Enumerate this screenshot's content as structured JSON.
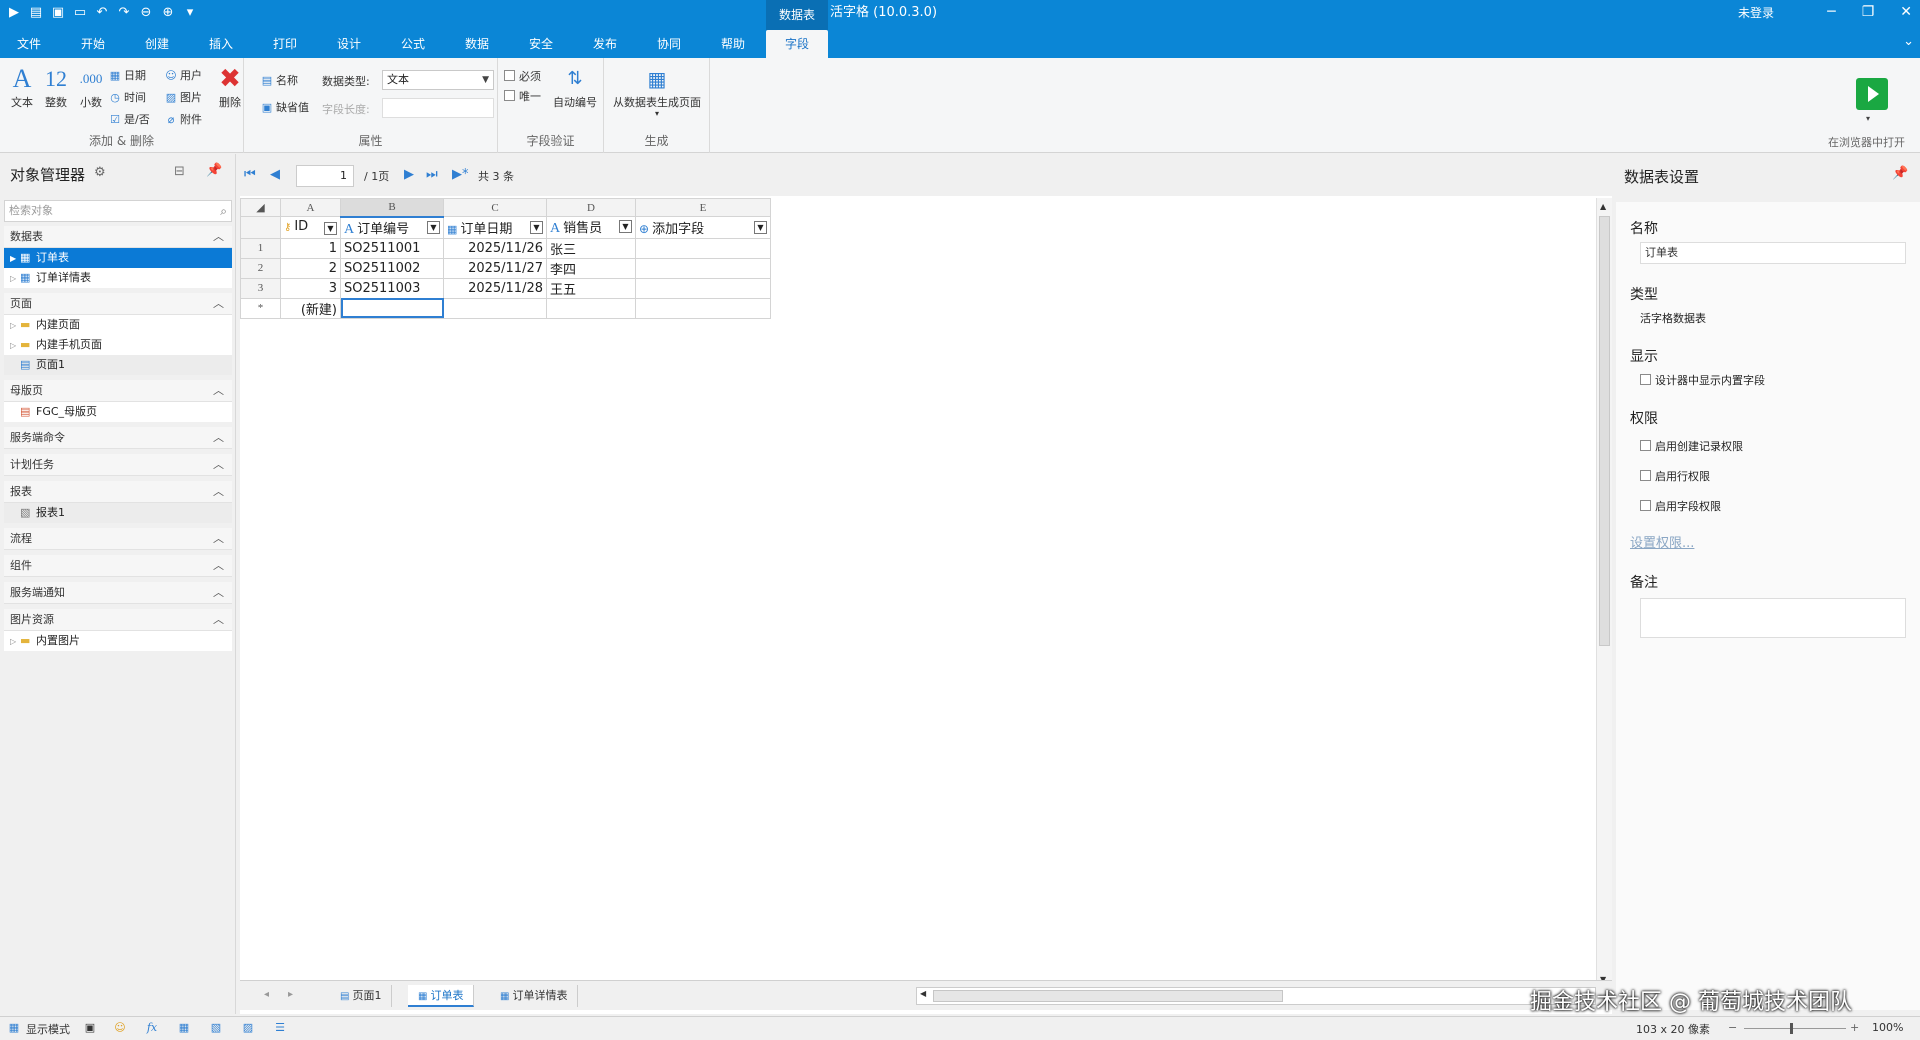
{
  "titlebar": {
    "context_tab": "数据表",
    "app_title": "活字格 (10.0.3.0)",
    "login": "未登录",
    "minimize": "─",
    "restore": "❐",
    "close": "✕"
  },
  "ribbon_tabs": [
    "文件",
    "开始",
    "创建",
    "插入",
    "打印",
    "设计",
    "公式",
    "数据",
    "安全",
    "发布",
    "协同",
    "帮助",
    "字段"
  ],
  "ribbon": {
    "add_delete": {
      "label": "添加 & 删除",
      "text": "文本",
      "int": "整数",
      "decimal": "小数",
      "date": "日期",
      "time": "时间",
      "bool": "是/否",
      "user": "用户",
      "image": "图片",
      "attachment": "附件",
      "delete": "删除"
    },
    "properties": {
      "label": "属性",
      "name": "名称",
      "default": "缺省值",
      "data_type_label": "数据类型:",
      "data_type_value": "文本",
      "length_label": "字段长度:"
    },
    "validation": {
      "label": "字段验证",
      "required": "必须",
      "unique": "唯一",
      "auto_number": "自动编号"
    },
    "generate": {
      "label": "生成",
      "from_table": "从数据表生成页面"
    },
    "open_browser": "在浏览器中打开"
  },
  "left_panel": {
    "title": "对象管理器",
    "search_placeholder": "检索对象",
    "categories": {
      "tables": "数据表",
      "pages": "页面",
      "master": "母版页",
      "server_cmd": "服务端命令",
      "scheduled": "计划任务",
      "reports": "报表",
      "flow": "流程",
      "component": "组件",
      "server_notify": "服务端通知",
      "images": "图片资源"
    },
    "items": {
      "order_table": "订单表",
      "order_detail_table": "订单详情表",
      "builtin_pages": "内建页面",
      "builtin_mobile": "内建手机页面",
      "page1": "页面1",
      "fgc_master": "FGC_母版页",
      "report1": "报表1",
      "builtin_images": "内置图片"
    }
  },
  "navbar": {
    "page_value": "1",
    "page_total": "/ 1页",
    "record_count": "共 3 条"
  },
  "sheet": {
    "col_letters": [
      "A",
      "B",
      "C",
      "D",
      "E"
    ],
    "fields": [
      "ID",
      "订单编号",
      "订单日期",
      "销售员",
      "添加字段"
    ],
    "rows": [
      {
        "n": "1",
        "id": "1",
        "code": "SO2511001",
        "date": "2025/11/26",
        "sales": "张三"
      },
      {
        "n": "2",
        "id": "2",
        "code": "SO2511002",
        "date": "2025/11/27",
        "sales": "李四"
      },
      {
        "n": "3",
        "id": "3",
        "code": "SO2511003",
        "date": "2025/11/28",
        "sales": "王五"
      }
    ],
    "new_row_marker": "*",
    "new_row_label": "(新建)"
  },
  "sheet_tabs": [
    "页面1",
    "订单表",
    "订单详情表"
  ],
  "right_panel": {
    "title": "数据表设置",
    "name_label": "名称",
    "name_value": "订单表",
    "type_label": "类型",
    "type_value": "活字格数据表",
    "display_label": "显示",
    "display_builtin": "设计器中显示内置字段",
    "perm_label": "权限",
    "perm_create": "启用创建记录权限",
    "perm_row": "启用行权限",
    "perm_field": "启用字段权限",
    "set_perm_link": "设置权限...",
    "remark_label": "备注"
  },
  "watermark": "掘金技术社区 @ 葡萄城技术团队",
  "statusbar": {
    "display_mode": "显示模式",
    "cell_size": "103 x 20 像素",
    "zoom": "100%",
    "zoom_level_percent": 100
  },
  "colors": {
    "accent": "#0b86d6",
    "selection": "#0b7ad6",
    "run": "#1aa842"
  }
}
